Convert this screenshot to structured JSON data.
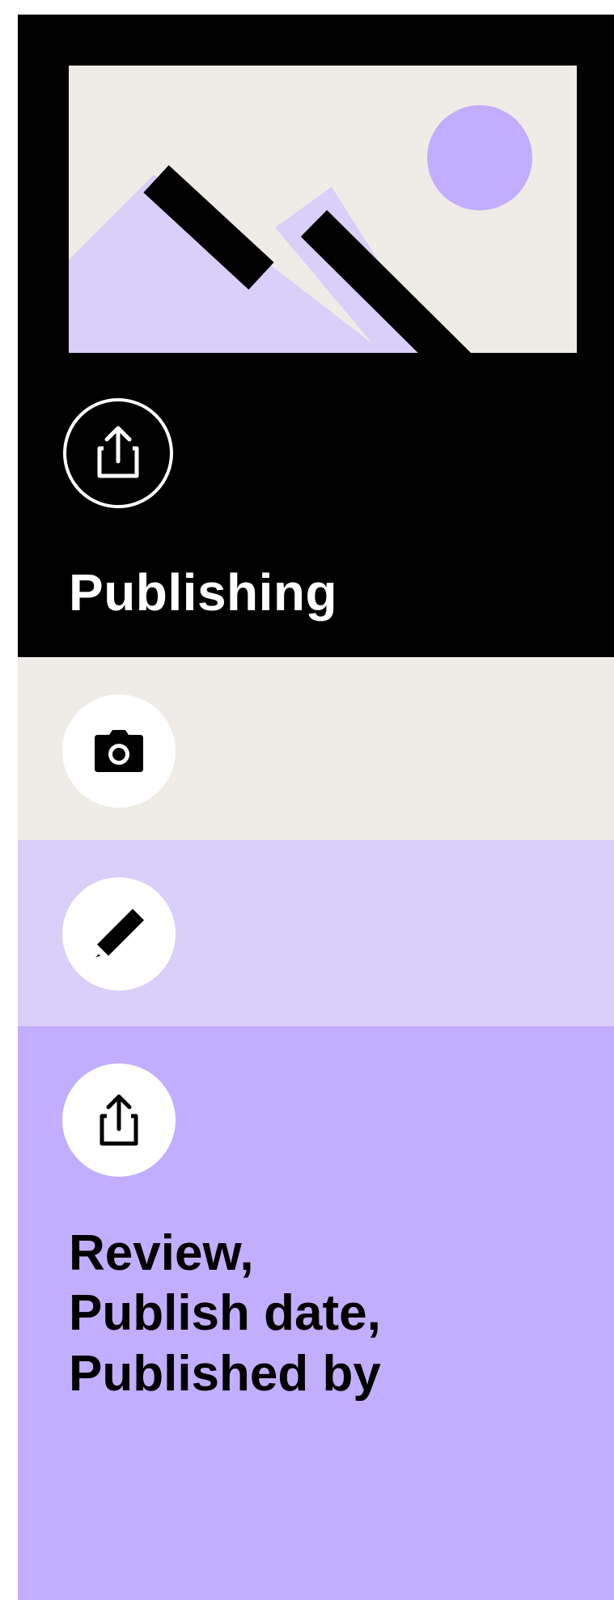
{
  "colors": {
    "hero_bg": "#000000",
    "camera_bg": "#efece7",
    "edit_bg": "#d9cff9",
    "publish_bg": "#c2aefe",
    "accent_purple": "#c2aefe",
    "light_purple": "#d9cff9",
    "cream": "#efece7"
  },
  "hero": {
    "image_icon": "image-placeholder-icon",
    "icon": "share-upload-icon",
    "title": "Publishing"
  },
  "steps": [
    {
      "icon": "camera-icon"
    },
    {
      "icon": "pencil-icon"
    },
    {
      "icon": "share-upload-icon",
      "lines": [
        "Review,",
        "Publish date,",
        "Published by"
      ]
    }
  ]
}
